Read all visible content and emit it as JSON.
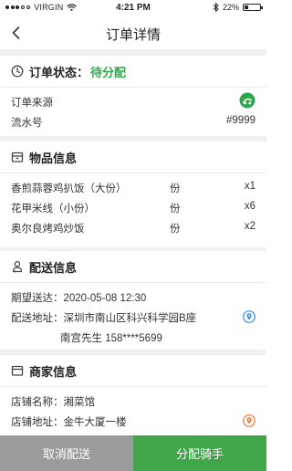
{
  "status_bar": {
    "carrier": "VIRGIN",
    "time": "4:21 PM",
    "battery_percent": "22%",
    "battery_level": 0.22
  },
  "nav": {
    "title": "订单详情",
    "back_icon": "chevron-left-icon"
  },
  "order": {
    "status_label": "订单状态：",
    "status_value": "待分配",
    "status_color": "#2ea84a",
    "source_label": "订单来源",
    "serial_label": "流水号",
    "serial_value": "#9999"
  },
  "items": {
    "title": "物品信息",
    "rows": [
      {
        "name": "香煎蒜蓉鸡扒饭（大份）",
        "unit": "份",
        "qty": "x1"
      },
      {
        "name": "花甲米线（小份）",
        "unit": "份",
        "qty": "x6"
      },
      {
        "name": "奥尔良烤鸡炒饭",
        "unit": "份",
        "qty": "x2"
      }
    ]
  },
  "delivery": {
    "title": "配送信息",
    "expected_label": "期望送达：",
    "expected_value": "2020-05-08  12:30",
    "address_label": "配送地址：",
    "address_value": "深圳市南山区科兴科学园B座",
    "recipient": "南宫先生  158****5699",
    "pin_color": "#3a8ee6"
  },
  "store": {
    "title": "商家信息",
    "name_label": "店铺名称：",
    "name_value": "湘菜馆",
    "address_label": "店铺地址：",
    "address_value": "金牛大厦一楼",
    "pin_color": "#f07a3a"
  },
  "actions": {
    "cancel_label": "取消配送",
    "assign_label": "分配骑手",
    "cancel_color": "#9b9b9b",
    "assign_color": "#41a54a"
  }
}
